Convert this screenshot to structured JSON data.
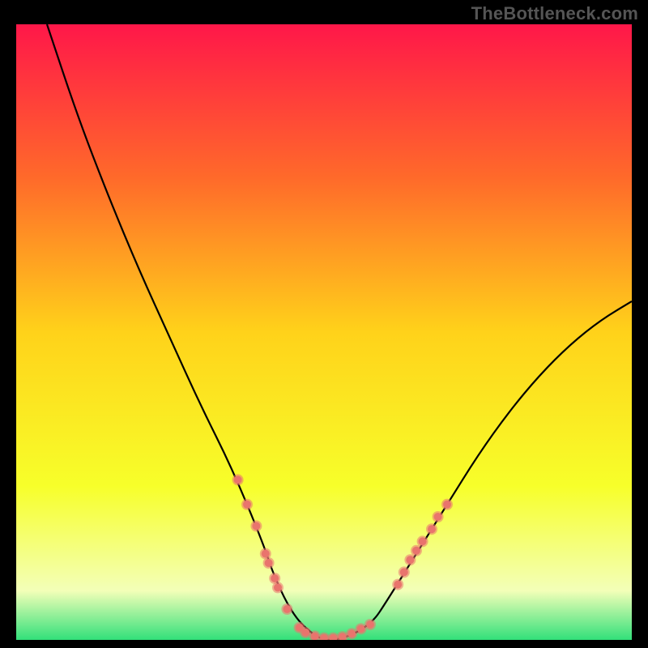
{
  "watermark": "TheBottleneck.com",
  "chart_data": {
    "type": "line",
    "title": "",
    "xlabel": "",
    "ylabel": "",
    "xlim": [
      0,
      100
    ],
    "ylim": [
      0,
      100
    ],
    "grid": false,
    "legend": false,
    "background_gradient": {
      "stops": [
        {
          "pos": 0.0,
          "color": "#ff1749"
        },
        {
          "pos": 0.25,
          "color": "#ff6a2a"
        },
        {
          "pos": 0.5,
          "color": "#ffd21a"
        },
        {
          "pos": 0.75,
          "color": "#f7ff2a"
        },
        {
          "pos": 0.92,
          "color": "#f3ffb8"
        },
        {
          "pos": 1.0,
          "color": "#32e07a"
        }
      ]
    },
    "series": [
      {
        "name": "bottleneck-curve",
        "color": "#000000",
        "x": [
          5,
          10,
          15,
          20,
          25,
          30,
          35,
          40,
          42,
          45,
          48,
          50,
          52,
          55,
          58,
          60,
          65,
          70,
          75,
          80,
          85,
          90,
          95,
          100
        ],
        "y": [
          100,
          85,
          72,
          60,
          49,
          38,
          28,
          16,
          10,
          4,
          1,
          0,
          0,
          1,
          3,
          6,
          14,
          22,
          30,
          37,
          43,
          48,
          52,
          55
        ]
      }
    ],
    "markers": {
      "name": "highlighted-points",
      "color": "#e9746d",
      "radius_outer": 7,
      "radius_inner": 5,
      "points": [
        {
          "x": 36,
          "y": 26
        },
        {
          "x": 37.5,
          "y": 22
        },
        {
          "x": 39,
          "y": 18.5
        },
        {
          "x": 40.5,
          "y": 14
        },
        {
          "x": 41,
          "y": 12.5
        },
        {
          "x": 42,
          "y": 10
        },
        {
          "x": 42.5,
          "y": 8.5
        },
        {
          "x": 44,
          "y": 5
        },
        {
          "x": 46,
          "y": 2
        },
        {
          "x": 47,
          "y": 1.2
        },
        {
          "x": 48.5,
          "y": 0.6
        },
        {
          "x": 50,
          "y": 0.3
        },
        {
          "x": 51.5,
          "y": 0.3
        },
        {
          "x": 53,
          "y": 0.5
        },
        {
          "x": 54.5,
          "y": 1
        },
        {
          "x": 56,
          "y": 1.8
        },
        {
          "x": 57.5,
          "y": 2.5
        },
        {
          "x": 62,
          "y": 9
        },
        {
          "x": 63,
          "y": 11
        },
        {
          "x": 64,
          "y": 13
        },
        {
          "x": 65,
          "y": 14.5
        },
        {
          "x": 66,
          "y": 16
        },
        {
          "x": 67.5,
          "y": 18
        },
        {
          "x": 68.5,
          "y": 20
        },
        {
          "x": 70,
          "y": 22
        }
      ]
    }
  }
}
